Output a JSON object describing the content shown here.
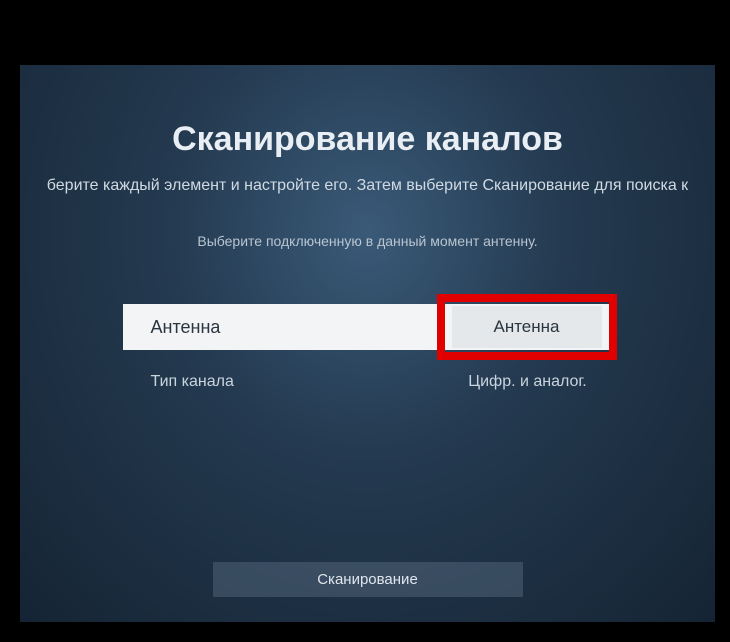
{
  "title": "Сканирование каналов",
  "subtitle": "берите каждый элемент и настройте его. Затем выберите Сканирование для поиска к",
  "instruction": "Выберите подключенную в данный момент антенну.",
  "rows": {
    "antenna": {
      "label": "Антенна",
      "value": "Антенна"
    },
    "channel_type": {
      "label": "Тип канала",
      "value": "Цифр. и аналог."
    }
  },
  "scan_button": "Сканирование"
}
